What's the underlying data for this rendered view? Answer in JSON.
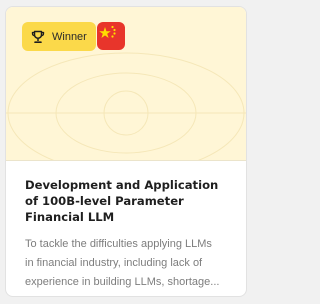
{
  "card": {
    "badge": {
      "label": "Winner",
      "icon": "trophy-icon",
      "color": "#fbd94a"
    },
    "flag": {
      "icon": "china-flag-icon",
      "color": "#e8352b",
      "star_color": "#ffde00"
    },
    "image_background": "#fff6d6",
    "title": "Development and Application of 100B-level Parameter Financial LLM",
    "description_lines": [
      "To tackle the difficulties applying LLMs",
      "in financial industry, including lack of",
      "experience in building LLMs, shortage..."
    ]
  }
}
